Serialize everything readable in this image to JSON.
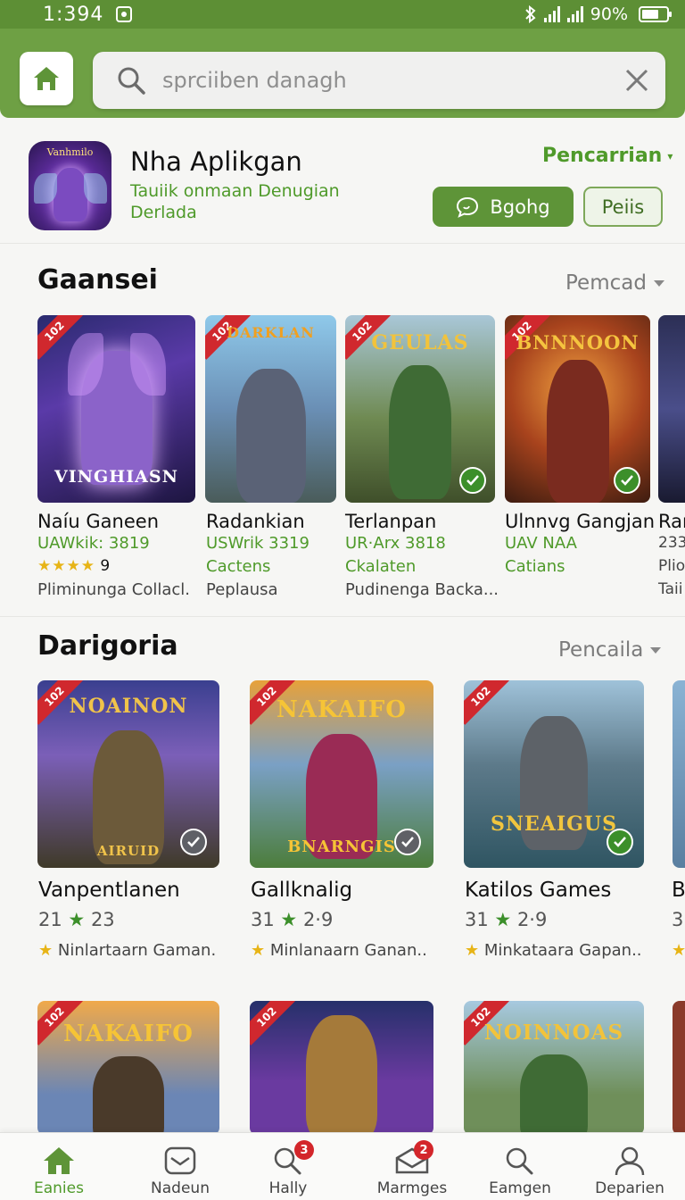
{
  "status_bar": {
    "time": "1:394",
    "battery": "90%"
  },
  "search": {
    "placeholder": "sprciiben danagh"
  },
  "app": {
    "title": "Nha Aplikgan",
    "subtitle": "Tauiik onmaan Denugian Derlada",
    "icon_text": "Vanhmilo",
    "sort_label": "Pencarrian",
    "primary_button": "Bgohg",
    "secondary_button": "Peiis"
  },
  "section1": {
    "title": "Gaansei",
    "more": "Pemcad",
    "cards": [
      {
        "art": "VINGHIASN",
        "badge": "102",
        "name": "Naíu Ganeen",
        "meta": "UAWkik: 3819",
        "stars": "★★★★",
        "rating": "9",
        "desc": "Pliminunga Collacl."
      },
      {
        "art": "DARKLAN",
        "badge": "102",
        "name": "Radankian",
        "meta": "USWrik 3319",
        "line2": "Cactens",
        "desc": "Peplausa"
      },
      {
        "art": "GEULAS",
        "badge": "102",
        "name": "Terlanpan",
        "meta": "UR·Arx 3818",
        "line2": "Ckalaten",
        "desc": "Pudinenga Backa..."
      },
      {
        "art": "BNNNOON",
        "badge": "102",
        "name": "Ulnnvg Gangjan",
        "meta": "UAV NAA",
        "line2": "Catians",
        "desc": ""
      },
      {
        "name": "Ran",
        "meta": "233",
        "line2": "Pliol",
        "desc": "Taii"
      }
    ]
  },
  "section2": {
    "title": "Darigoria",
    "more": "Pencaila",
    "cards": [
      {
        "art": "NOAINON",
        "badge": "102",
        "bottom_art": "AIRUID",
        "name": "Vanpentlanen",
        "rating_left": "21",
        "rating_right": "23",
        "desc": "Ninlartaarn Gaman."
      },
      {
        "art": "NAKAIFO",
        "badge": "102",
        "bottom_art": "BNARNGIS",
        "name": "Gallknalig",
        "rating_left": "31",
        "rating_right": "2·9",
        "desc": "Minlanaarn Ganan.."
      },
      {
        "art": "SNEAIGUS",
        "badge": "102",
        "name": "Katilos Games",
        "rating_left": "31",
        "rating_right": "2·9",
        "desc": "Minkataara Gapan.."
      },
      {
        "name": "B",
        "rating_left": "3"
      }
    ]
  },
  "section3": {
    "cards": [
      {
        "art": "NAKAIFO",
        "badge": "102"
      },
      {
        "art": "",
        "badge": "102"
      },
      {
        "art": "NOINNOAS",
        "badge": "102"
      }
    ]
  },
  "nav": [
    {
      "label": "Eanies",
      "active": true
    },
    {
      "label": "Nadeun"
    },
    {
      "label": "Hally",
      "badge": "3"
    },
    {
      "label": "Marmges",
      "badge": "2"
    },
    {
      "label": "Eamgen"
    },
    {
      "label": "Deparien"
    }
  ],
  "colors": {
    "brand": "#6ea044",
    "accent": "#4f9a2a",
    "badge_red": "#d0282e"
  }
}
